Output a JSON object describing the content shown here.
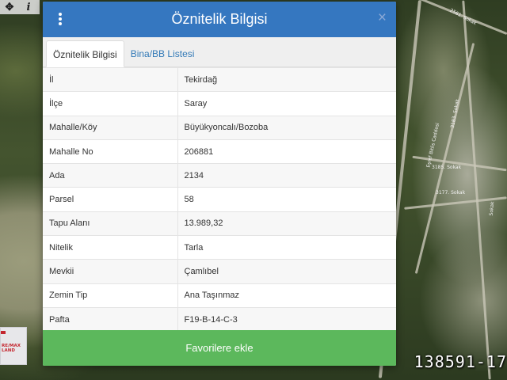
{
  "dialog": {
    "title": "Öznitelik Bilgisi",
    "close_symbol": "×",
    "tabs": [
      {
        "label": "Öznitelik Bilgisi",
        "active": true
      },
      {
        "label": "Bina/BB Listesi",
        "active": false
      }
    ],
    "rows": [
      {
        "key": "İl",
        "value": "Tekirdağ"
      },
      {
        "key": "İlçe",
        "value": "Saray"
      },
      {
        "key": "Mahalle/Köy",
        "value": "Büyükyoncalı/Bozoba"
      },
      {
        "key": "Mahalle No",
        "value": "206881"
      },
      {
        "key": "Ada",
        "value": "2134"
      },
      {
        "key": "Parsel",
        "value": "58"
      },
      {
        "key": "Tapu Alanı",
        "value": "13.989,32"
      },
      {
        "key": "Nitelik",
        "value": "Tarla"
      },
      {
        "key": "Mevkii",
        "value": "Çamlıbel"
      },
      {
        "key": "Zemin Tip",
        "value": "Ana Taşınmaz"
      },
      {
        "key": "Pafta",
        "value": "F19-B-14-C-3"
      }
    ],
    "favorite_button": "Favorilere ekle"
  },
  "map": {
    "tools": [
      {
        "icon": "crosshair-icon",
        "glyph": "✥"
      },
      {
        "icon": "info-icon",
        "glyph": "i"
      }
    ],
    "street_labels": [
      "2561. Sokak",
      "3185. Sokak",
      "3177. Sokak",
      "Eşref Bitlis Caddesi",
      "3183. Sokak",
      "Sokak"
    ],
    "logo_text": "RE/MAX LAND",
    "watermark": "138591-17"
  },
  "colors": {
    "header": "#3577c0",
    "favorite_button": "#5cb85c",
    "tab_link": "#337ab7"
  }
}
